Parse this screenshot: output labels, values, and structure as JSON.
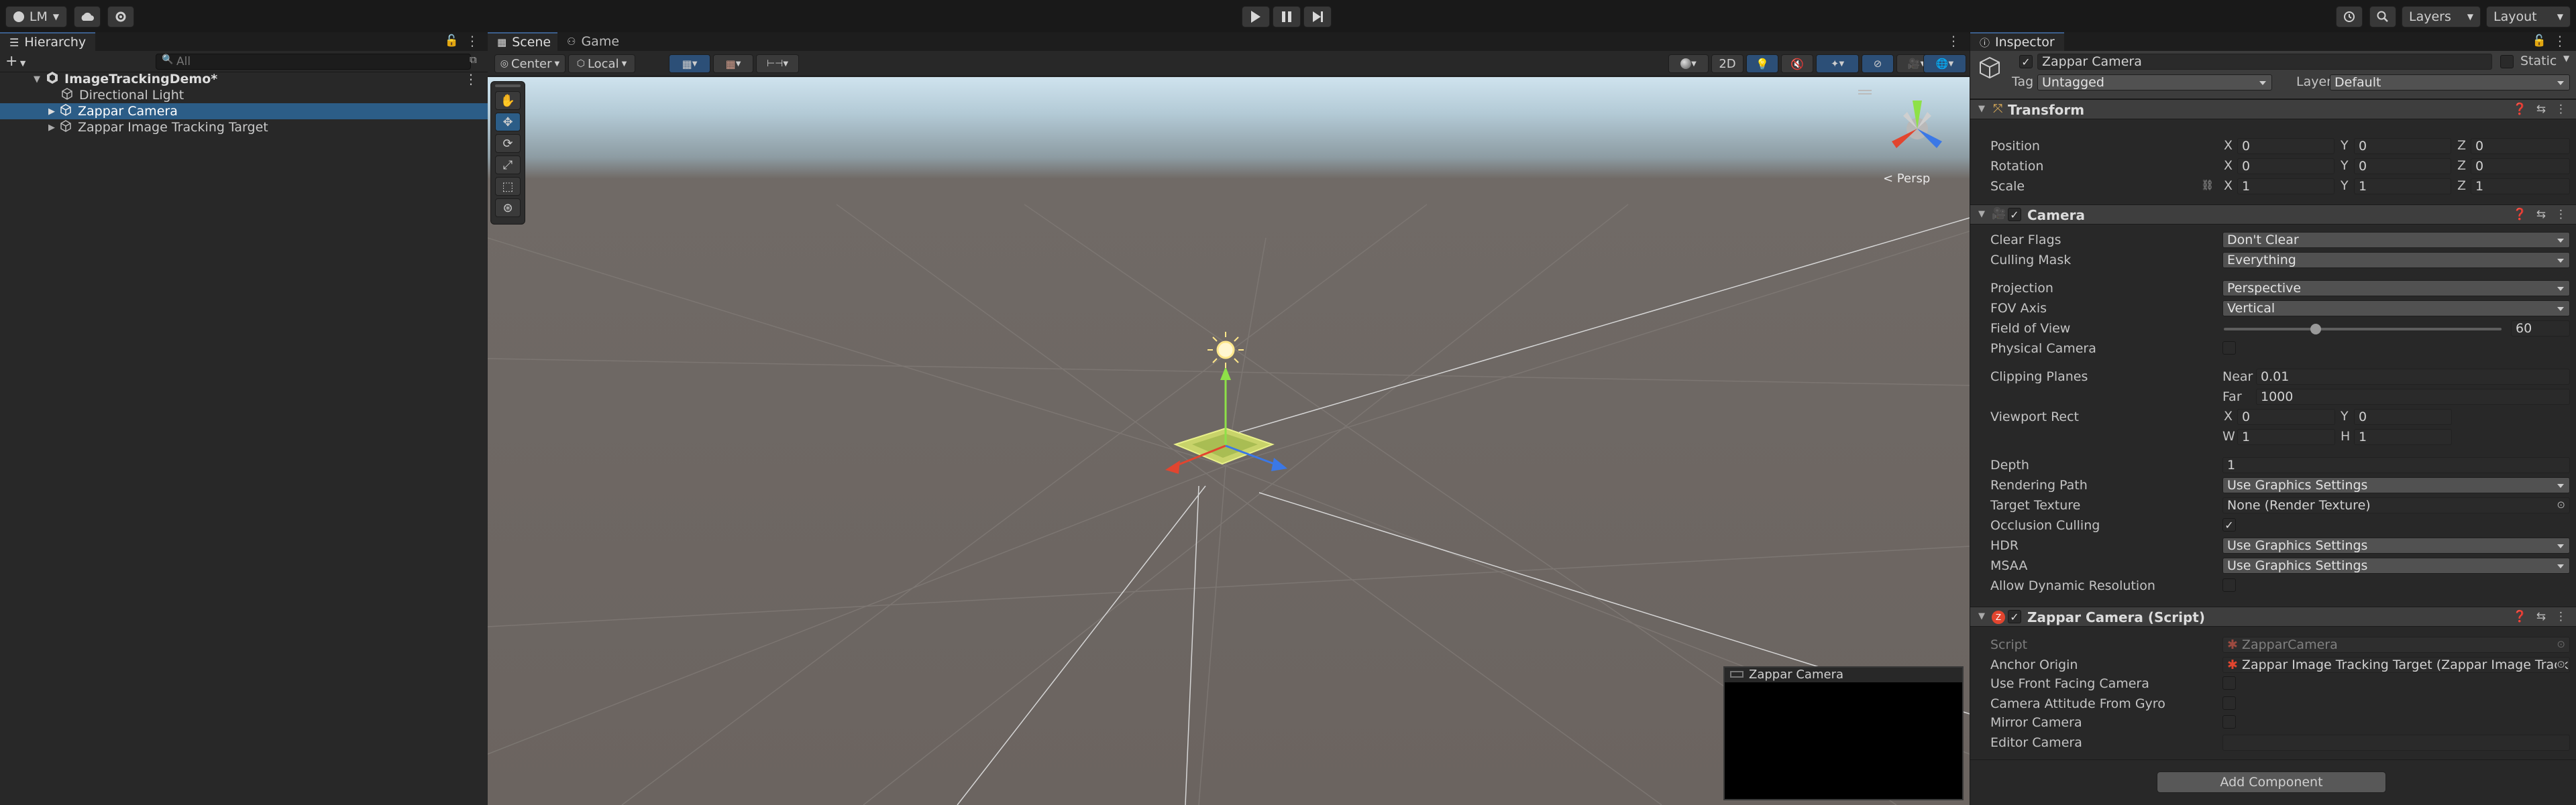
{
  "toolbar": {
    "account": "LM",
    "layers": "Layers",
    "layout": "Layout"
  },
  "hierarchy": {
    "tab": "Hierarchy",
    "search_placeholder": "All",
    "scene_name": "ImageTrackingDemo*",
    "items": [
      "Directional Light",
      "Zappar Camera",
      "Zappar Image Tracking Target"
    ]
  },
  "scene": {
    "tabs": [
      "Scene",
      "Game"
    ],
    "pivot": "Center",
    "space": "Local",
    "mode_2d": "2D",
    "persp": "< Persp",
    "preview_title": "Zappar Camera"
  },
  "inspector": {
    "tab": "Inspector",
    "object_name": "Zappar Camera",
    "static_label": "Static",
    "tag_label": "Tag",
    "tag": "Untagged",
    "layer_label": "Layer",
    "layer": "Default",
    "transform": {
      "title": "Transform",
      "position_label": "Position",
      "rotation_label": "Rotation",
      "scale_label": "Scale",
      "position": {
        "x": "0",
        "y": "0",
        "z": "0"
      },
      "rotation": {
        "x": "0",
        "y": "0",
        "z": "0"
      },
      "scale": {
        "x": "1",
        "y": "1",
        "z": "1"
      }
    },
    "camera": {
      "title": "Camera",
      "clear_flags_label": "Clear Flags",
      "clear_flags": "Don't Clear",
      "culling_mask_label": "Culling Mask",
      "culling_mask": "Everything",
      "projection_label": "Projection",
      "projection": "Perspective",
      "fov_axis_label": "FOV Axis",
      "fov_axis": "Vertical",
      "fov_label": "Field of View",
      "fov": "60",
      "fov_fraction": 0.33,
      "physical_label": "Physical Camera",
      "clipping_label": "Clipping Planes",
      "near_label": "Near",
      "near": "0.01",
      "far_label": "Far",
      "far": "1000",
      "viewport_label": "Viewport Rect",
      "vp_x": "0",
      "vp_y": "0",
      "vp_w": "1",
      "vp_h": "1",
      "depth_label": "Depth",
      "depth": "1",
      "rendering_label": "Rendering Path",
      "rendering": "Use Graphics Settings",
      "target_label": "Target Texture",
      "target": "None (Render Texture)",
      "occlusion_label": "Occlusion Culling",
      "hdr_label": "HDR",
      "hdr": "Use Graphics Settings",
      "msaa_label": "MSAA",
      "msaa": "Use Graphics Settings",
      "dynres_label": "Allow Dynamic Resolution"
    },
    "script": {
      "title": "Zappar Camera (Script)",
      "script_label": "Script",
      "script": "ZapparCamera",
      "anchor_label": "Anchor Origin",
      "anchor": "Zappar Image Tracking Target (Zappar Image Tracking",
      "front_label": "Use Front Facing Camera",
      "gyro_label": "Camera Attitude From Gyro",
      "mirror_label": "Mirror Camera",
      "editor_label": "Editor Camera"
    },
    "add_component": "Add Component"
  },
  "axes": {
    "x": "X",
    "y": "Y",
    "z": "Z",
    "w": "W",
    "h": "H"
  }
}
